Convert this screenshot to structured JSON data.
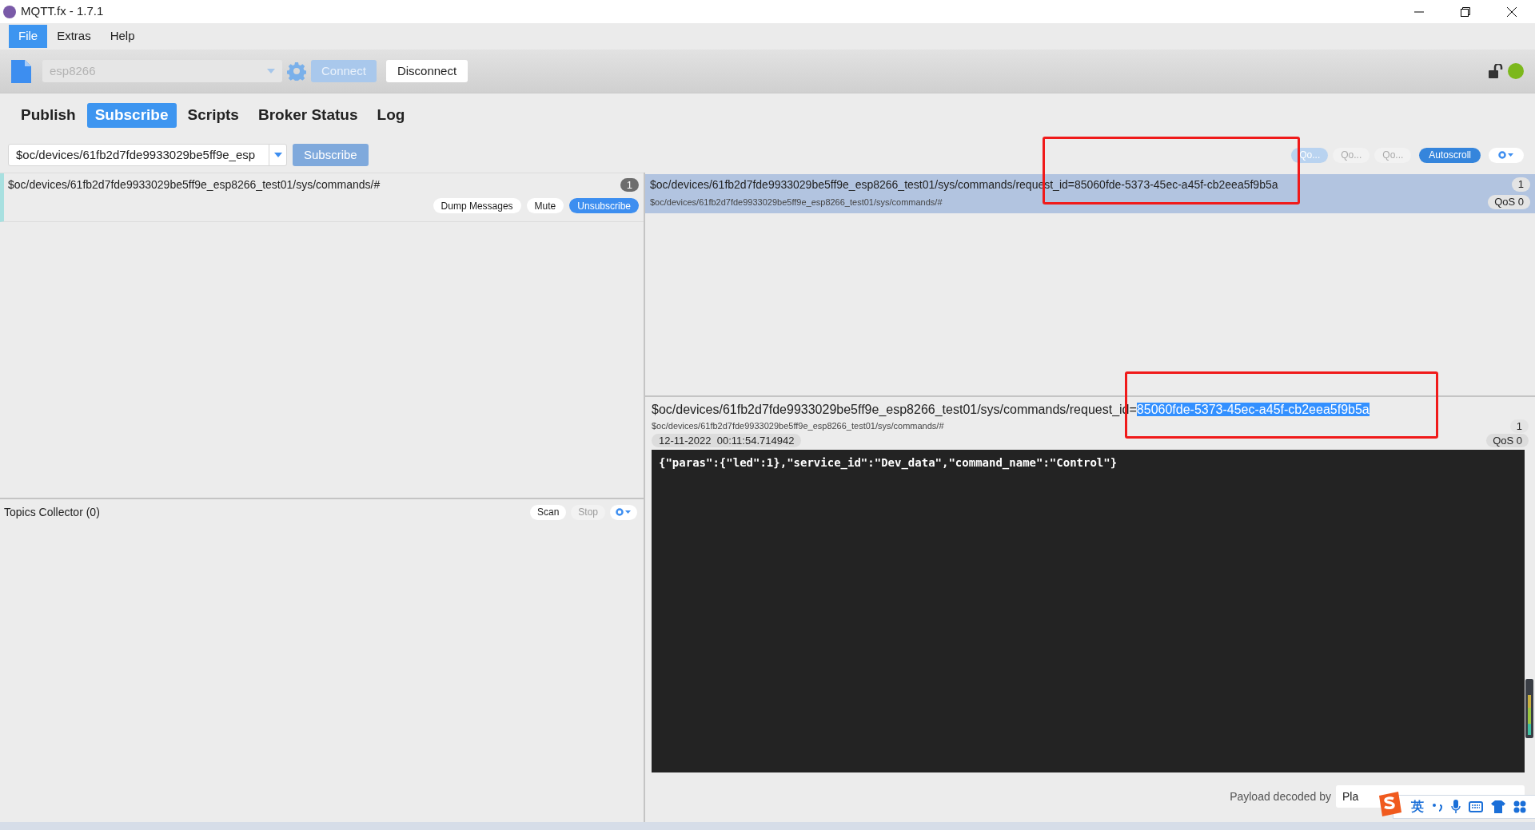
{
  "window": {
    "title": "MQTT.fx - 1.7.1"
  },
  "menu": [
    {
      "label": "File",
      "selected": true
    },
    {
      "label": "Extras",
      "selected": false
    },
    {
      "label": "Help",
      "selected": false
    }
  ],
  "toolbar": {
    "profile": "esp8266",
    "connect": "Connect",
    "disconnect": "Disconnect",
    "connected": true
  },
  "tabs": [
    {
      "label": "Publish",
      "selected": false
    },
    {
      "label": "Subscribe",
      "selected": true
    },
    {
      "label": "Scripts",
      "selected": false
    },
    {
      "label": "Broker Status",
      "selected": false
    },
    {
      "label": "Log",
      "selected": false
    }
  ],
  "subscribe_bar": {
    "topic": "$oc/devices/61fb2d7fde9933029be5ff9e_esp",
    "button": "Subscribe"
  },
  "message_toolbar": {
    "qos_filters": [
      {
        "label": "Qo...",
        "selected": true
      },
      {
        "label": "Qo...",
        "selected": false
      },
      {
        "label": "Qo...",
        "selected": false
      }
    ],
    "autoscroll": {
      "label": "Autoscroll",
      "on": true
    }
  },
  "subscriptions": [
    {
      "topic": "$oc/devices/61fb2d7fde9933029be5ff9e_esp8266_test01/sys/commands/#",
      "count": "1",
      "actions": [
        "Dump Messages",
        "Mute",
        "Unsubscribe"
      ]
    }
  ],
  "topics_collector": {
    "title": "Topics Collector (0)",
    "scan": "Scan",
    "stop": "Stop"
  },
  "messages": [
    {
      "topic": "$oc/devices/61fb2d7fde9933029be5ff9e_esp8266_test01/sys/commands/request_id=85060fde-5373-45ec-a45f-cb2eea5f9b5a",
      "subscription": "$oc/devices/61fb2d7fde9933029be5ff9e_esp8266_test01/sys/commands/#",
      "number": "1",
      "qos": "QoS 0",
      "selected": true
    }
  ],
  "detail": {
    "topic": "$oc/devices/61fb2d7fde9933029be5ff9e_esp8266_test01/sys/commands/request_id=",
    "topic_selected_part": "85060fde-5373-45ec-a45f-cb2eea5f9b5a",
    "subscription": "$oc/devices/61fb2d7fde9933029be5ff9e_esp8266_test01/sys/commands/#",
    "number": "1",
    "timestamp": "12-11-2022  00:11:54.714942",
    "qos": "QoS 0",
    "payload": "{\"paras\":{\"led\":1},\"service_id\":\"Dev_data\",\"command_name\":\"Control\"}"
  },
  "decoder": {
    "label": "Payload decoded by",
    "value": "Pla"
  },
  "ime_toolbar": {
    "mode": "英"
  }
}
